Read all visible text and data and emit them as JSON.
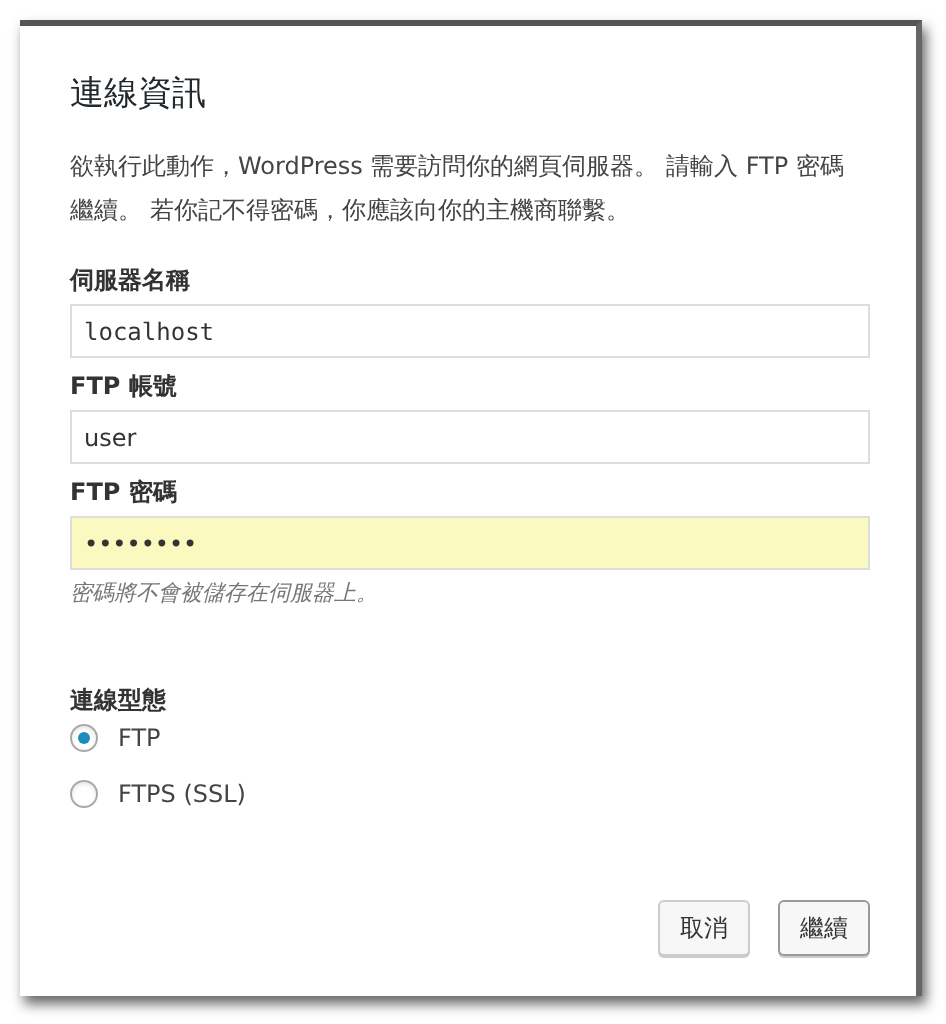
{
  "dialog": {
    "title": "連線資訊",
    "description": "欲執行此動作，WordPress 需要訪問你的網頁伺服器。 請輸入 FTP 密碼繼續。 若你記不得密碼，你應該向你的主機商聯繫。",
    "fields": [
      {
        "label": "伺服器名稱",
        "value": "localhost",
        "kind": "mono",
        "autofilled": false
      },
      {
        "label": "FTP 帳號",
        "value": "user",
        "kind": "text",
        "autofilled": false
      },
      {
        "label": "FTP 密碼",
        "value": "••••••••",
        "kind": "text",
        "autofilled": true,
        "hint": "密碼將不會被儲存在伺服器上。"
      }
    ],
    "connection_type": {
      "label": "連線型態",
      "options": [
        {
          "label": "FTP",
          "selected": true
        },
        {
          "label": "FTPS (SSL)",
          "selected": false
        }
      ]
    },
    "buttons": [
      {
        "label": "取消",
        "kind": "secondary"
      },
      {
        "label": "繼續",
        "kind": "primary"
      }
    ]
  }
}
